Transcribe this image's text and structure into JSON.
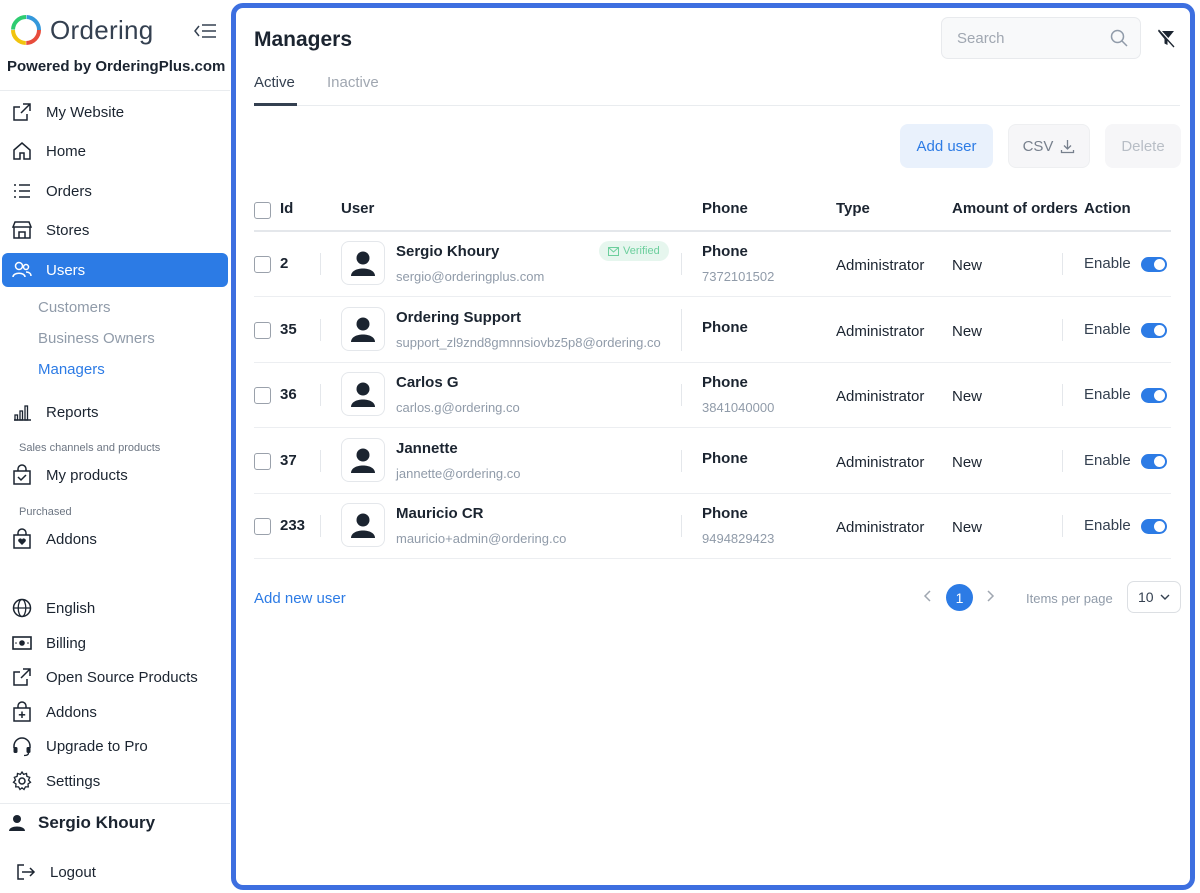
{
  "app": {
    "logo_text": "Ordering",
    "powered_by": "Powered by OrderingPlus.com"
  },
  "sidebar": {
    "items": [
      {
        "label": "My Website",
        "icon": "external-link-icon"
      },
      {
        "label": "Home",
        "icon": "home-icon"
      },
      {
        "label": "Orders",
        "icon": "list-icon"
      },
      {
        "label": "Stores",
        "icon": "store-icon"
      },
      {
        "label": "Users",
        "icon": "users-icon",
        "active": true
      },
      {
        "label": "Reports",
        "icon": "bar-chart-icon"
      },
      {
        "label": "My products",
        "icon": "bag-check-icon"
      },
      {
        "label": "Addons",
        "icon": "bag-heart-icon"
      },
      {
        "label": "English",
        "icon": "globe-icon"
      },
      {
        "label": "Billing",
        "icon": "cash-icon"
      },
      {
        "label": "Open Source Products",
        "icon": "external-link-icon"
      },
      {
        "label": "Addons",
        "icon": "bag-plus-icon"
      },
      {
        "label": "Upgrade to Pro",
        "icon": "headset-icon"
      },
      {
        "label": "Settings",
        "icon": "gear-icon"
      }
    ],
    "sub_items": [
      "Customers",
      "Business Owners",
      "Managers"
    ],
    "active_sub": "Managers",
    "section_sales": "Sales channels and products",
    "section_purchased": "Purchased",
    "user_name": "Sergio Khoury",
    "logout": "Logout"
  },
  "main": {
    "title": "Managers",
    "search_placeholder": "Search",
    "tabs": [
      "Active",
      "Inactive"
    ],
    "buttons": {
      "add": "Add user",
      "csv": "CSV",
      "delete": "Delete"
    },
    "columns": [
      "Id",
      "User",
      "Phone",
      "Type",
      "Amount of orders",
      "Action"
    ],
    "rows": [
      {
        "id": "2",
        "name": "Sergio Khoury",
        "email": "sergio@orderingplus.com",
        "verified": "Verified",
        "phone_label": "Phone",
        "phone": "7372101502",
        "type": "Administrator",
        "orders": "New",
        "action": "Enable"
      },
      {
        "id": "35",
        "name": "Ordering Support",
        "email": "support_zl9znd8gmnnsiovbz5p8@ordering.co",
        "verified": "",
        "phone_label": "Phone",
        "phone": "",
        "type": "Administrator",
        "orders": "New",
        "action": "Enable"
      },
      {
        "id": "36",
        "name": "Carlos G",
        "email": "carlos.g@ordering.co",
        "verified": "",
        "phone_label": "Phone",
        "phone": "3841040000",
        "type": "Administrator",
        "orders": "New",
        "action": "Enable"
      },
      {
        "id": "37",
        "name": "Jannette",
        "email": "jannette@ordering.co",
        "verified": "",
        "phone_label": "Phone",
        "phone": "",
        "type": "Administrator",
        "orders": "New",
        "action": "Enable"
      },
      {
        "id": "233",
        "name": "Mauricio CR",
        "email": "mauricio+admin@ordering.co",
        "verified": "",
        "phone_label": "Phone",
        "phone": "9494829423",
        "type": "Administrator",
        "orders": "New",
        "action": "Enable"
      }
    ],
    "add_new_user": "Add new user",
    "current_page": "1",
    "items_per_page_label": "Items per page",
    "items_per_page": "10"
  },
  "colors": {
    "accent": "#2c7be5",
    "frame": "#3d6fe0",
    "verified_bg": "#e6f6ee",
    "verified_text": "#6ccf9d"
  }
}
